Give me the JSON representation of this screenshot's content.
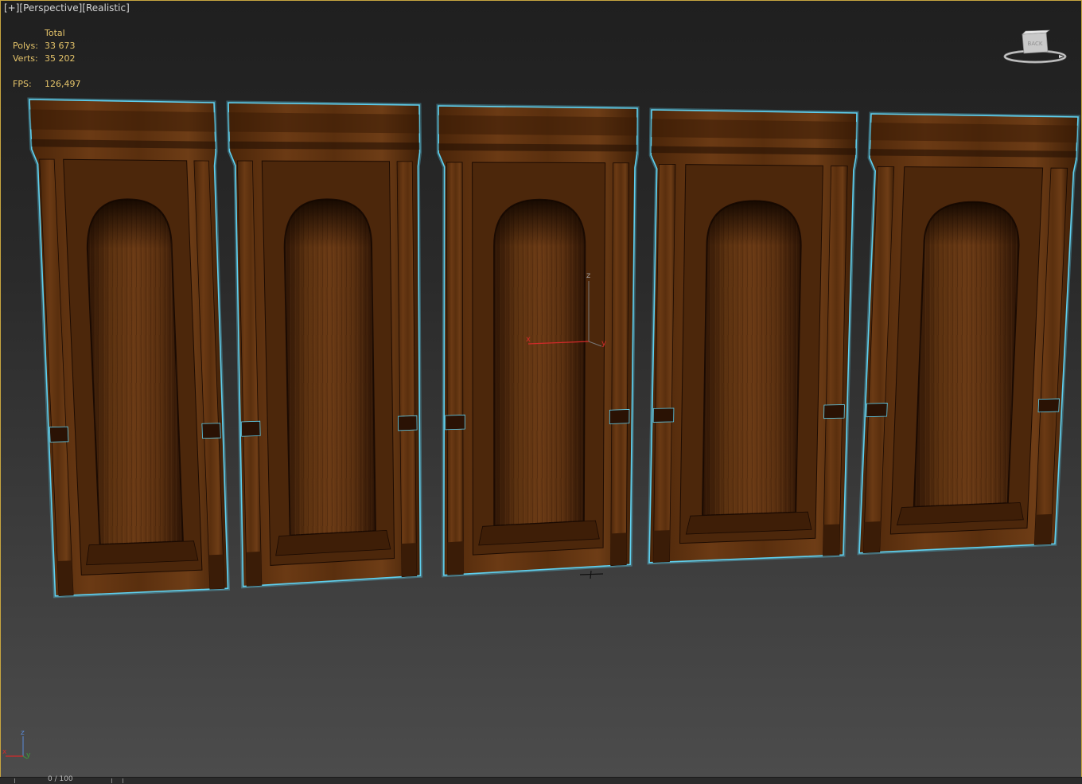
{
  "viewport": {
    "label_plus": "[+]",
    "label_view": "[Perspective]",
    "label_shading": "[Realistic]"
  },
  "stats": {
    "total_label": "Total",
    "polys_label": "Polys:",
    "polys_value": "33 673",
    "verts_label": "Verts:",
    "verts_value": "35 202",
    "fps_label": "FPS:",
    "fps_value": "126,497"
  },
  "viewcube": {
    "face_label": "BACK"
  },
  "gizmo": {
    "x": "x",
    "y": "y",
    "z": "z"
  },
  "corner_axes": {
    "x": "x",
    "y": "y",
    "z": "z"
  },
  "timeline": {
    "frame_text": "0 / 100"
  },
  "colors": {
    "selection_outline": "#5fd0ef",
    "wood_dark": "#2e1606",
    "wood_mid": "#5a300f",
    "wood_light": "#7a4419",
    "stats_text": "#e5c46a",
    "viewport_border": "#c8a640",
    "axis_x": "#e03030"
  },
  "panels_count_label": "",
  "icons": [
    "viewcube-icon",
    "transform-gizmo-icon",
    "world-axis-icon"
  ]
}
